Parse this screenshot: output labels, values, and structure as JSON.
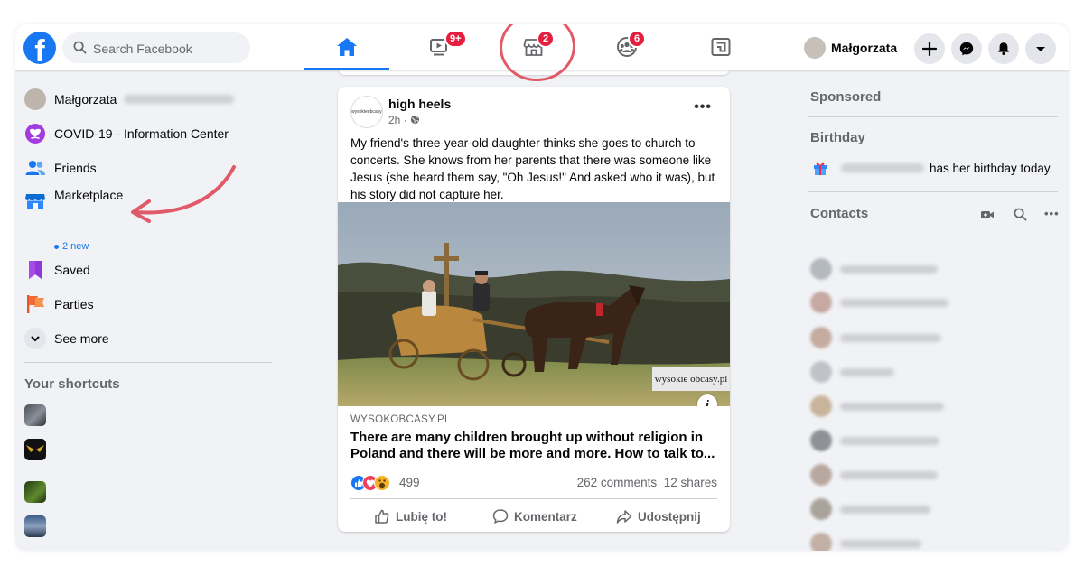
{
  "header": {
    "logo_letter": "f",
    "search_placeholder": "Search Facebook",
    "watch_badge": "9+",
    "marketplace_badge": "2",
    "groups_badge": "6",
    "profile_name": "Małgorzata"
  },
  "sidebar": {
    "profile_name": "Małgorzata",
    "covid": "COVID-19 - Information Center",
    "friends": "Friends",
    "marketplace": "Marketplace",
    "marketplace_sub": "2 new",
    "saved": "Saved",
    "parties": "Parties",
    "see_more": "See more",
    "shortcuts_title": "Your shortcuts"
  },
  "post": {
    "page_name": "high heels",
    "time": "2h",
    "avatar_text": "wysokieobcasy.pl",
    "text": "My friend's three-year-old daughter thinks she goes to church to concerts. She knows from her parents that there was someone like Jesus (she heard them say, \"Oh Jesus!\" And asked who it was), but his story did not capture her.",
    "watermark": "wysokie obcasy.pl",
    "link_domain": "WYSOKOBCASY.PL",
    "link_title": "There are many children brought up without religion in Poland and there will be more and more. How to talk to...",
    "reactions_count": "499",
    "comments": "262 comments",
    "shares": "12 shares",
    "like_label": "Lubię to!",
    "comment_label": "Komentarz",
    "share_label": "Udostępnij"
  },
  "right": {
    "sponsored": "Sponsored",
    "birthday_title": "Birthday",
    "birthday_text": "has her birthday today.",
    "contacts_title": "Contacts"
  },
  "colors": {
    "brand": "#1877f2",
    "badge": "#e41e3f",
    "annotation": "#e05a67"
  }
}
